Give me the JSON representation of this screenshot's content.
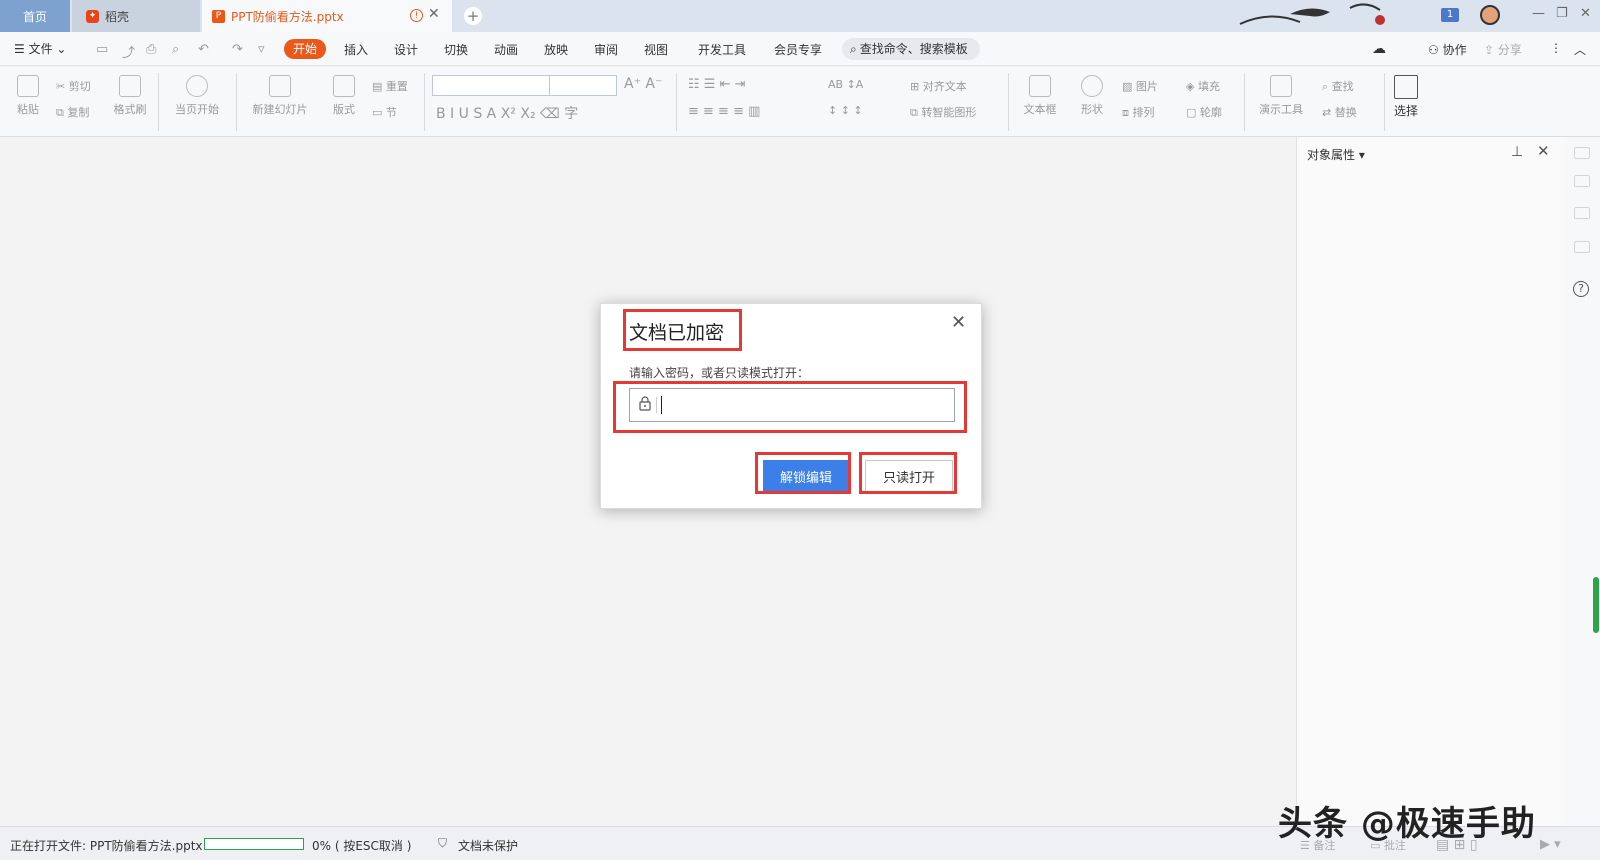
{
  "tabs": {
    "home": "首页",
    "daoke": "稻壳",
    "document": "PPT防偷看方法.pptx",
    "badge": "1"
  },
  "menu": {
    "file": "文件",
    "items": [
      "开始",
      "插入",
      "设计",
      "切换",
      "动画",
      "放映",
      "审阅",
      "视图",
      "开发工具",
      "会员专享"
    ],
    "search": "查找命令、搜索模板",
    "collab": "协作",
    "share": "分享"
  },
  "ribbon": {
    "paste": "粘贴",
    "cut": "剪切",
    "copy": "复制",
    "format_painter": "格式刷",
    "from_current": "当页开始",
    "new_slide": "新建幻灯片",
    "layout": "版式",
    "reset": "重置",
    "section": "节",
    "align_text": "对齐文本",
    "smart_art": "转智能图形",
    "textbox": "文本框",
    "shape": "形状",
    "picture": "图片",
    "fill": "填充",
    "arrange": "排列",
    "outline": "轮廓",
    "present_tools": "演示工具",
    "find": "查找",
    "replace": "替换",
    "select": "选择"
  },
  "panel": {
    "title": "对象属性"
  },
  "dialog": {
    "title": "文档已加密",
    "prompt": "请输入密码，或者只读模式打开：",
    "password_value": "",
    "unlock_button": "解锁编辑",
    "readonly_button": "只读打开"
  },
  "status": {
    "opening": "正在打开文件: PPT防偷看方法.pptx",
    "progress_percent": 0,
    "progress_text": "0%  ( 按ESC取消 )",
    "protection": "文档未保护",
    "notes": "备注",
    "comments": "批注"
  },
  "watermark": "头条 @极速手助",
  "colors": {
    "accent": "#e8591a",
    "primary_button": "#3c7fe8",
    "annotation": "#e53935",
    "progress": "#2fa24b"
  }
}
